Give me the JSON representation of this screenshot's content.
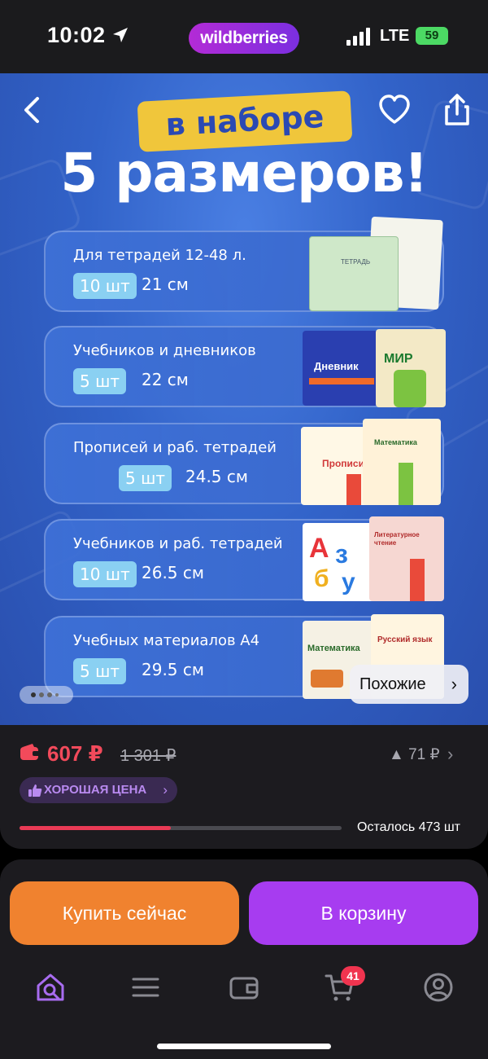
{
  "status_bar": {
    "time": "10:02",
    "app_pill": "wildberries",
    "network": "LTE",
    "battery": "59"
  },
  "hero": {
    "banner": "в наборе",
    "headline": "5 размеров!",
    "cards": [
      {
        "title": "Для тетрадей 12-48 л.",
        "qty": "10 шт",
        "size": "21 см"
      },
      {
        "title": "Учебников и дневников",
        "qty": "5 шт",
        "size": "22 см"
      },
      {
        "title": "Прописей и раб. тетрадей",
        "qty": "5 шт",
        "size": "24.5 см"
      },
      {
        "title": "Учебников и раб. тетрадей",
        "qty": "10 шт",
        "size": "26.5 см"
      },
      {
        "title": "Учебных материалов А4",
        "qty": "5 шт",
        "size": "29.5 см"
      }
    ],
    "book_labels": {
      "notebook": "ТЕТРАДЬ",
      "diary": "Дневник",
      "world": "МИР",
      "propisi": "Прописи",
      "math": "Математика",
      "litread": "Литературное чтение",
      "abc": "Азбука",
      "russian": "Русский язык"
    },
    "similar_button": "Похожие",
    "carousel_position": {
      "current": 1,
      "total": 4
    }
  },
  "price": {
    "current": "607 ₽",
    "old": "1 301 ₽",
    "delta": "▲ 71 ₽",
    "good_price_label": "ХОРОШАЯ ЦЕНА",
    "stock_text": "Осталось 473 шт",
    "stock_fraction": 0.47
  },
  "actions": {
    "buy_now": "Купить сейчас",
    "add_to_cart": "В корзину"
  },
  "nav": {
    "cart_badge": "41",
    "items": [
      "home-search-icon",
      "menu-icon",
      "wallet-icon",
      "cart-icon",
      "profile-icon"
    ]
  },
  "colors": {
    "accent_purple": "#a73cf0",
    "accent_orange": "#f0822f",
    "price_red": "#f24a5b"
  }
}
